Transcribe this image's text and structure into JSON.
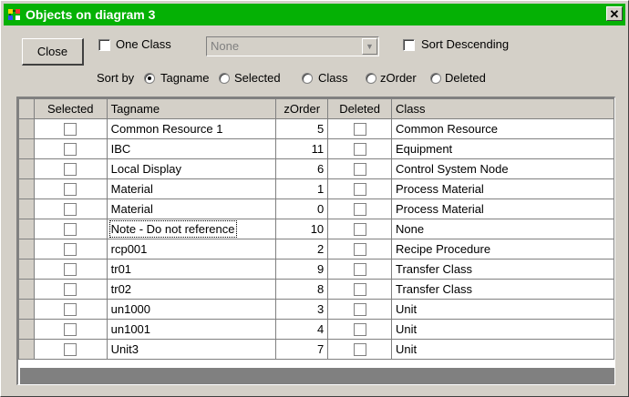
{
  "window": {
    "title": "Objects on diagram 3",
    "accent": "#05b105"
  },
  "toolbar": {
    "close_label": "Close",
    "one_class_label": "One Class",
    "one_class_value": "None",
    "sort_desc_label": "Sort Descending"
  },
  "sort": {
    "label": "Sort by",
    "options": [
      "Tagname",
      "Selected",
      "Class",
      "zOrder",
      "Deleted"
    ],
    "selected": "Tagname"
  },
  "table": {
    "columns": [
      "Selected",
      "Tagname",
      "zOrder",
      "Deleted",
      "Class"
    ],
    "rows": [
      {
        "tagname": "Common Resource 1",
        "zorder": "5",
        "class": "Common Resource"
      },
      {
        "tagname": "IBC",
        "zorder": "11",
        "class": "Equipment"
      },
      {
        "tagname": "Local Display",
        "zorder": "6",
        "class": "Control System Node"
      },
      {
        "tagname": "Material",
        "zorder": "1",
        "class": "Process Material"
      },
      {
        "tagname": "Material",
        "zorder": "0",
        "class": "Process Material"
      },
      {
        "tagname": "Note - Do not reference",
        "zorder": "10",
        "class": "None"
      },
      {
        "tagname": "rcp001",
        "zorder": "2",
        "class": "Recipe Procedure"
      },
      {
        "tagname": "tr01",
        "zorder": "9",
        "class": "Transfer Class"
      },
      {
        "tagname": "tr02",
        "zorder": "8",
        "class": "Transfer Class"
      },
      {
        "tagname": "un1000",
        "zorder": "3",
        "class": "Unit"
      },
      {
        "tagname": "un1001",
        "zorder": "4",
        "class": "Unit"
      },
      {
        "tagname": "Unit3",
        "zorder": "7",
        "class": "Unit"
      }
    ]
  }
}
